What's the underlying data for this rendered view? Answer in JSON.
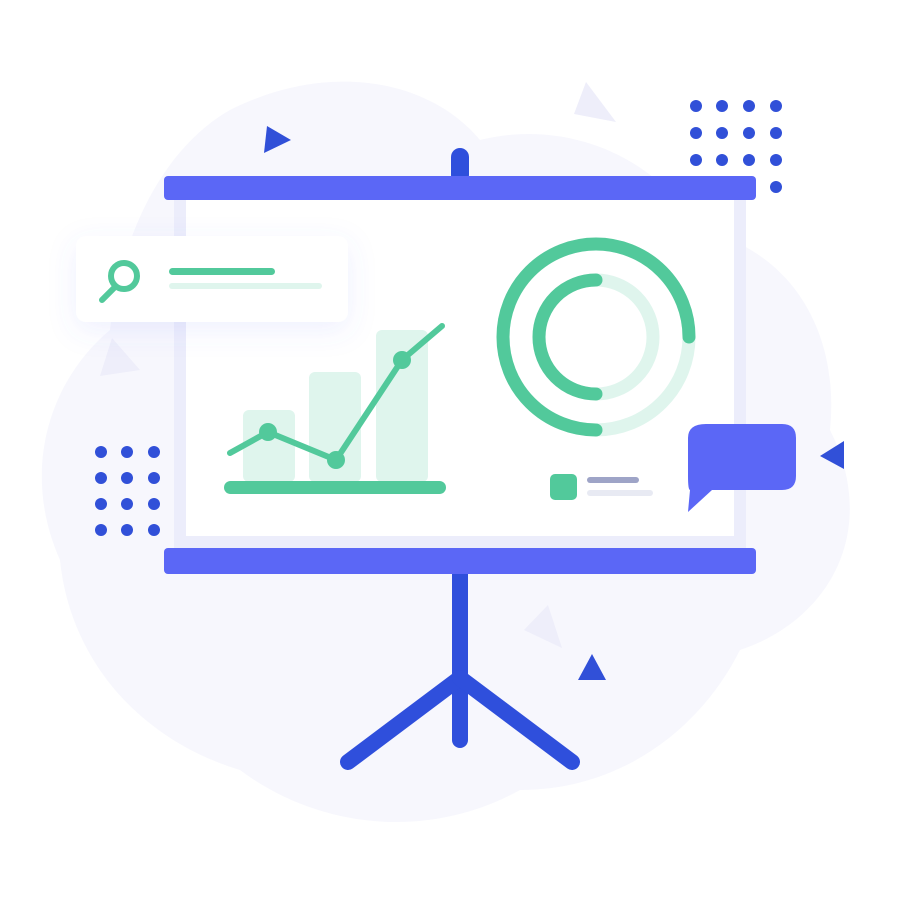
{
  "illustration": {
    "colors": {
      "blob": "#f7f7fd",
      "frame_bar": "#5b67f6",
      "stand": "#2f4fdc",
      "screen_border": "#ecedfb",
      "screen_fill": "#ffffff",
      "accent_green": "#52c99b",
      "green_light": "#dff5ed",
      "dots": "#3150d8",
      "triangle_dark": "#3150d8",
      "triangle_light": "#eeeefa",
      "chat_bubble": "#5b67f6",
      "search_card": "#ffffff",
      "legend_line_dark": "#9ea4c7",
      "legend_line_light": "#e8eaf3"
    },
    "icons": {
      "search": "magnifier-icon",
      "chat": "speech-bubble-icon",
      "play": "triangle-icon"
    },
    "bar_chart": {
      "bars": [
        0.55,
        0.82,
        1.0
      ],
      "trend": [
        0.55,
        0.4,
        0.3,
        0.72,
        1.0
      ]
    },
    "donut": {
      "outer_fraction": 0.75,
      "inner_fraction": 0.5
    }
  }
}
